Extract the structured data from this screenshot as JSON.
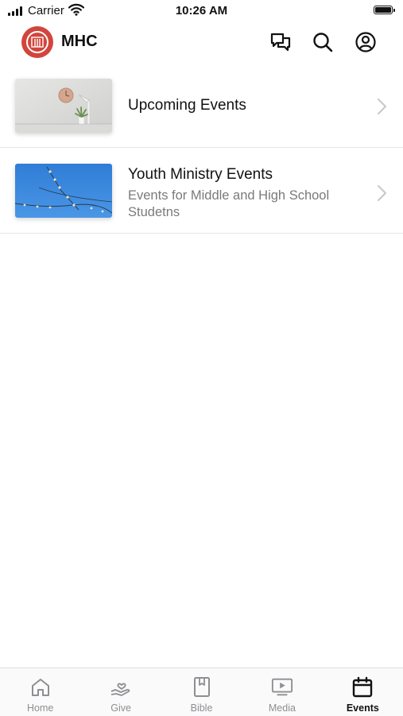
{
  "status_bar": {
    "carrier": "Carrier",
    "time": "10:26 AM"
  },
  "header": {
    "app_name": "MHC"
  },
  "events_list": [
    {
      "title": "Upcoming Events",
      "subtitle": "",
      "thumbnail": "wall-clock-interior-photo"
    },
    {
      "title": "Youth Ministry Events",
      "subtitle": "Events for Middle and High School Studetns",
      "thumbnail": "string-lights-blue-sky-photo"
    }
  ],
  "tabs": [
    {
      "label": "Home",
      "icon": "home-icon",
      "active": false
    },
    {
      "label": "Give",
      "icon": "give-icon",
      "active": false
    },
    {
      "label": "Bible",
      "icon": "bible-icon",
      "active": false
    },
    {
      "label": "Media",
      "icon": "media-icon",
      "active": false
    },
    {
      "label": "Events",
      "icon": "calendar-icon",
      "active": true
    }
  ],
  "colors": {
    "brand": "#d2453c",
    "active_tab": "#111111",
    "inactive_tab": "#8e8e93"
  }
}
